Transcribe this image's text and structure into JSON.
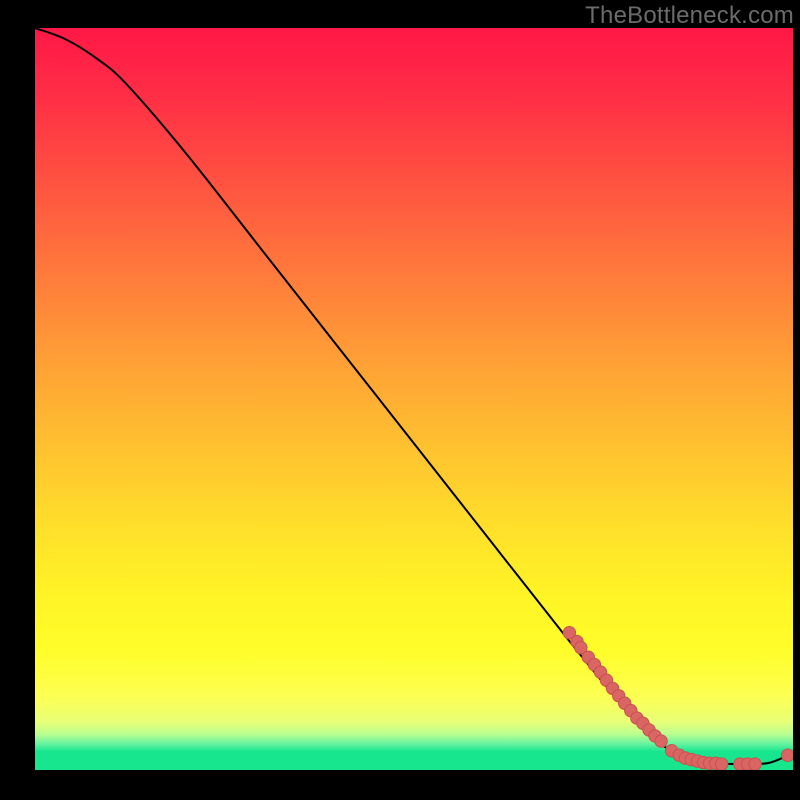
{
  "watermark": "TheBottleneck.com",
  "chart_data": {
    "type": "line",
    "title": "",
    "xlabel": "",
    "ylabel": "",
    "xlim": [
      0,
      100
    ],
    "ylim": [
      0,
      100
    ],
    "curve": [
      {
        "x": 0,
        "y": 100
      },
      {
        "x": 4,
        "y": 98.5
      },
      {
        "x": 8,
        "y": 96
      },
      {
        "x": 12,
        "y": 92.5
      },
      {
        "x": 20,
        "y": 83
      },
      {
        "x": 30,
        "y": 70
      },
      {
        "x": 40,
        "y": 57
      },
      {
        "x": 50,
        "y": 44
      },
      {
        "x": 60,
        "y": 31
      },
      {
        "x": 70,
        "y": 18
      },
      {
        "x": 76,
        "y": 10.5
      },
      {
        "x": 80,
        "y": 6
      },
      {
        "x": 83,
        "y": 3.2
      },
      {
        "x": 86,
        "y": 1.6
      },
      {
        "x": 90,
        "y": 0.9
      },
      {
        "x": 94,
        "y": 0.8
      },
      {
        "x": 97,
        "y": 1.0
      },
      {
        "x": 100,
        "y": 2.3
      }
    ],
    "points": [
      {
        "x": 70.5,
        "y": 18.5
      },
      {
        "x": 71.5,
        "y": 17.3
      },
      {
        "x": 72.0,
        "y": 16.5
      },
      {
        "x": 73.0,
        "y": 15.2
      },
      {
        "x": 73.8,
        "y": 14.2
      },
      {
        "x": 74.6,
        "y": 13.2
      },
      {
        "x": 75.4,
        "y": 12.1
      },
      {
        "x": 76.2,
        "y": 11.0
      },
      {
        "x": 77.0,
        "y": 10.0
      },
      {
        "x": 77.8,
        "y": 9.0
      },
      {
        "x": 78.6,
        "y": 8.0
      },
      {
        "x": 79.4,
        "y": 7.0
      },
      {
        "x": 80.2,
        "y": 6.3
      },
      {
        "x": 81.0,
        "y": 5.4
      },
      {
        "x": 81.8,
        "y": 4.6
      },
      {
        "x": 82.6,
        "y": 3.9
      },
      {
        "x": 84.0,
        "y": 2.6
      },
      {
        "x": 85.0,
        "y": 2.0
      },
      {
        "x": 85.8,
        "y": 1.6
      },
      {
        "x": 86.6,
        "y": 1.4
      },
      {
        "x": 87.4,
        "y": 1.2
      },
      {
        "x": 88.2,
        "y": 1.0
      },
      {
        "x": 89.0,
        "y": 0.9
      },
      {
        "x": 89.8,
        "y": 0.9
      },
      {
        "x": 90.6,
        "y": 0.8
      },
      {
        "x": 93.0,
        "y": 0.8
      },
      {
        "x": 94.0,
        "y": 0.8
      },
      {
        "x": 95.0,
        "y": 0.8
      },
      {
        "x": 99.3,
        "y": 2.0
      }
    ],
    "point_color": "#d96663"
  }
}
